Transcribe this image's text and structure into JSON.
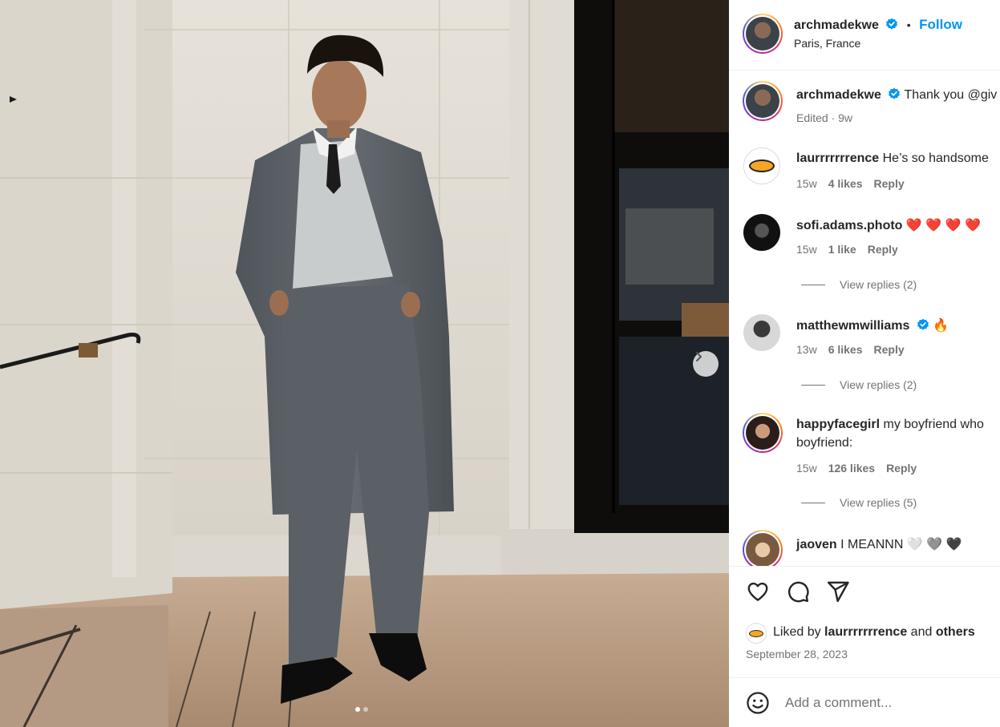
{
  "post": {
    "author": "archmadekwe",
    "location": "Paris, France",
    "follow_label": "Follow",
    "separator": "•",
    "caption_text": "Thank you @giv",
    "caption_meta": "Edited · 9w"
  },
  "comments": [
    {
      "user": "laurrrrrrrence",
      "text": "He’s so handsome",
      "age": "15w",
      "likes": "4 likes",
      "reply": "Reply"
    },
    {
      "user": "sofi.adams.photo",
      "text": "❤️ ❤️ ❤️ ❤️",
      "age": "15w",
      "likes": "1 like",
      "reply": "Reply",
      "view_replies": "View replies (2)"
    },
    {
      "user": "matthewmwilliams",
      "text": "🔥",
      "age": "13w",
      "likes": "6 likes",
      "reply": "Reply",
      "view_replies": "View replies (2)"
    },
    {
      "user": "happyfacegirl",
      "text": "my boyfriend who",
      "text2": "boyfriend:",
      "age": "15w",
      "likes": "126 likes",
      "reply": "Reply",
      "view_replies": "View replies (5)"
    },
    {
      "user": "jaoven",
      "text": "I MEANNN 🤍 🩶 🖤"
    }
  ],
  "liked_by": {
    "prefix": "Liked by",
    "user": "laurrrrrrrence",
    "and": "and",
    "others": "others"
  },
  "date": "September 28, 2023",
  "add_comment_placeholder": "Add a comment...",
  "icons": {
    "like": "heart-icon",
    "comment": "comment-icon",
    "share": "paper-plane-icon",
    "emoji": "emoji-icon",
    "next": "chevron-right-icon",
    "verified": "verified-badge-icon"
  },
  "colors": {
    "accent": "#0095f6",
    "text": "#262626",
    "muted": "#737373",
    "verified": "#0095f6"
  },
  "carousel": {
    "slides": 2,
    "active": 1
  }
}
